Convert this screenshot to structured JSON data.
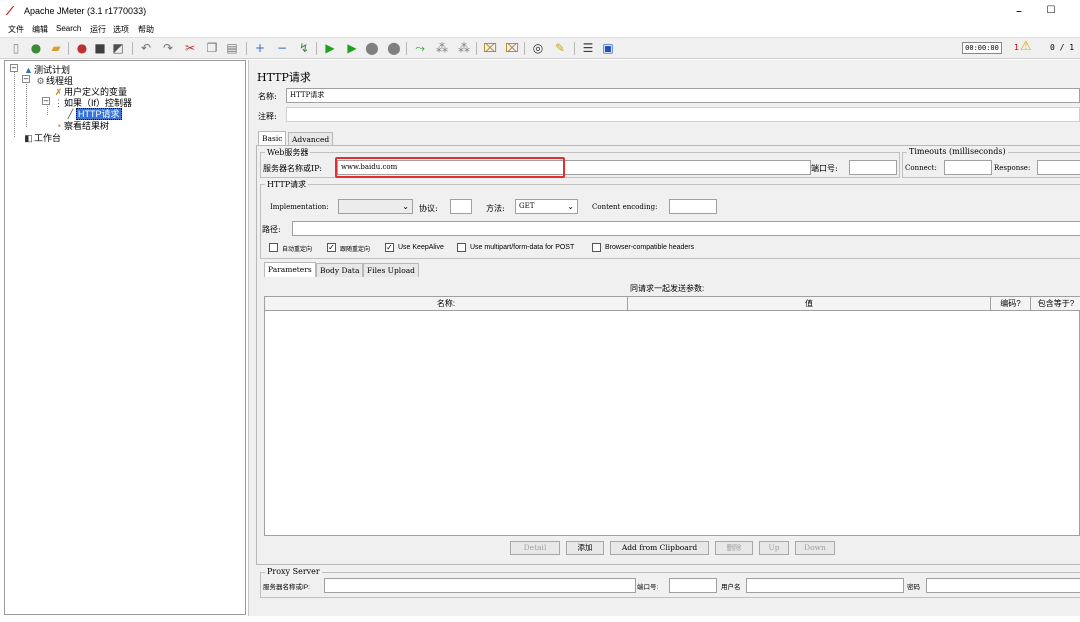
{
  "window": {
    "title": "Apache JMeter (3.1 r1770033)",
    "minimize": "–",
    "maximize": "☐"
  },
  "menu": [
    "文件",
    "编辑",
    "Search",
    "运行",
    "选项",
    "帮助"
  ],
  "status": {
    "timer": "00:00:00",
    "errors": "1",
    "threads": "0 / 1"
  },
  "tree": {
    "test_plan": "测试计划",
    "thread_group": "线程组",
    "user_vars": "用户定义的变量",
    "if_controller": "如果（If）控制器",
    "http_request": "HTTP请求",
    "result_tree": "察看结果树",
    "workbench": "工作台"
  },
  "panel": {
    "title": "HTTP请求",
    "name_label": "名称:",
    "name_value": "HTTP请求",
    "comment_label": "注释:",
    "tab_basic": "Basic",
    "tab_advanced": "Advanced",
    "web_server_group": "Web服务器",
    "server_label": "服务器名称或IP:",
    "server_value": "www.baidu.com",
    "port_label": "端口号:",
    "timeouts_group": "Timeouts (milliseconds)",
    "connect_label": "Connect:",
    "response_label": "Response:",
    "http_group": "HTTP请求",
    "implementation_label": "Implementation:",
    "protocol_label": "协议:",
    "method_label": "方法:",
    "method_value": "GET",
    "encoding_label": "Content encoding:",
    "path_label": "路径:",
    "checkboxes": [
      {
        "label": "自动重定向",
        "checked": false
      },
      {
        "label": "跟随重定向",
        "checked": true
      },
      {
        "label": "Use KeepAlive",
        "checked": true
      },
      {
        "label": "Use multipart/form-data for POST",
        "checked": false
      },
      {
        "label": "Browser-compatible headers",
        "checked": false
      }
    ],
    "subtabs": [
      "Parameters",
      "Body Data",
      "Files Upload"
    ],
    "params_caption": "同请求一起发送参数:",
    "columns": [
      "名称:",
      "值",
      "编码?",
      "包含等于?"
    ],
    "buttons": [
      "Detail",
      "添加",
      "Add from Clipboard",
      "删除",
      "Up",
      "Down"
    ],
    "proxy_group": "Proxy Server",
    "proxy_server_label": "服务器名称或IP:",
    "proxy_port_label": "端口号:",
    "proxy_user_label": "用户名",
    "proxy_pass_label": "密码"
  }
}
